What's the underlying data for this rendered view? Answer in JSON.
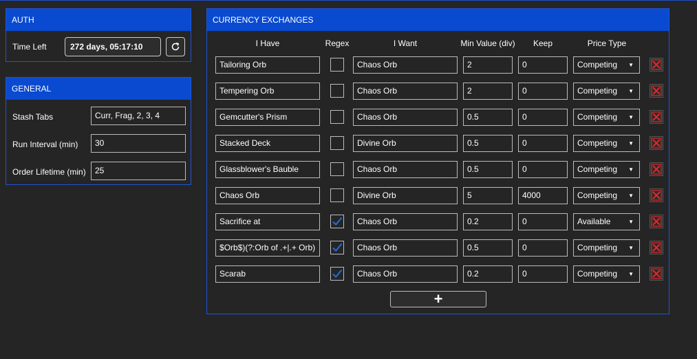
{
  "colors": {
    "accent": "#0a4ad0",
    "check": "#1f6fe0",
    "delete": "#e0282b"
  },
  "auth": {
    "title": "AUTH",
    "time_left_label": "Time Left",
    "time_left_value": "272 days, 05:17:10",
    "refresh_icon": "refresh-icon"
  },
  "general": {
    "title": "GENERAL",
    "fields": [
      {
        "label": "Stash Tabs",
        "value": "Curr, Frag, 2, 3, 4"
      },
      {
        "label": "Run Interval (min)",
        "value": "30"
      },
      {
        "label": "Order Lifetime (min)",
        "value": "25"
      }
    ]
  },
  "exchanges": {
    "title": "CURRENCY EXCHANGES",
    "columns": {
      "have": "I Have",
      "regex": "Regex",
      "want": "I Want",
      "min_value": "Min Value (div)",
      "keep": "Keep",
      "price_type": "Price Type"
    },
    "rows": [
      {
        "have": "Tailoring Orb",
        "regex": false,
        "want": "Chaos Orb",
        "min": "2",
        "keep": "0",
        "price": "Competing"
      },
      {
        "have": "Tempering Orb",
        "regex": false,
        "want": "Chaos Orb",
        "min": "2",
        "keep": "0",
        "price": "Competing"
      },
      {
        "have": "Gemcutter's Prism",
        "regex": false,
        "want": "Chaos Orb",
        "min": "0.5",
        "keep": "0",
        "price": "Competing"
      },
      {
        "have": "Stacked Deck",
        "regex": false,
        "want": "Divine Orb",
        "min": "0.5",
        "keep": "0",
        "price": "Competing"
      },
      {
        "have": "Glassblower's Bauble",
        "regex": false,
        "want": "Chaos Orb",
        "min": "0.5",
        "keep": "0",
        "price": "Competing"
      },
      {
        "have": "Chaos Orb",
        "regex": false,
        "want": "Divine Orb",
        "min": "5",
        "keep": "4000",
        "price": "Competing"
      },
      {
        "have": "Sacrifice at",
        "regex": true,
        "want": "Chaos Orb",
        "min": "0.2",
        "keep": "0",
        "price": "Available"
      },
      {
        "have": "Orb$)(?:Orb of .+|.+ Orb)$",
        "regex": true,
        "want": "Chaos Orb",
        "min": "0.5",
        "keep": "0",
        "price": "Competing"
      },
      {
        "have": "Scarab",
        "regex": true,
        "want": "Chaos Orb",
        "min": "0.2",
        "keep": "0",
        "price": "Competing"
      }
    ],
    "add_label": "+"
  }
}
